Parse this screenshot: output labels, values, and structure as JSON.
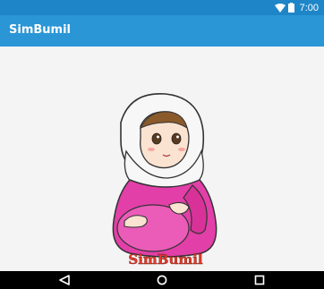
{
  "status_bar": {
    "time": "7:00",
    "icons": [
      "wifi-icon",
      "battery-icon"
    ]
  },
  "app_bar": {
    "title": "SimBumil"
  },
  "splash": {
    "logo_text": "SimBumil",
    "image": "pregnant-woman-hijab-illustration"
  },
  "nav_bar": {
    "buttons": [
      "back-icon",
      "home-icon",
      "recents-icon"
    ]
  },
  "colors": {
    "status_bar": "#1e86c8",
    "app_bar": "#2a96d6",
    "dress": "#e23fa8",
    "logo": "#e23a2a",
    "nav_bar": "#000000"
  }
}
